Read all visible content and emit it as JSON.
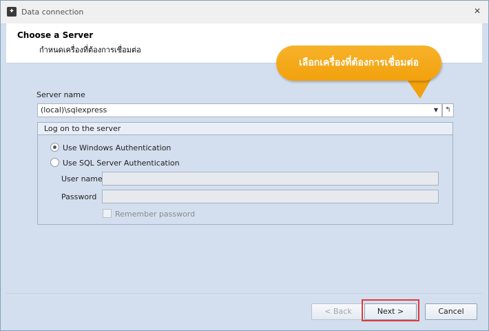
{
  "window": {
    "title": "Data connection",
    "close_glyph": "✕",
    "app_icon": "wizard-icon"
  },
  "header": {
    "title": "Choose a Server",
    "subtitle": "กำหนดเครื่องที่ต้องการเชื่อมต่อ"
  },
  "callout": {
    "text": "เลือกเครื่องที่ต้องการเชื่อมต่อ",
    "color": "#f2a10c"
  },
  "server": {
    "label": "Server name",
    "value": "(local)\\sqlexpress"
  },
  "logon_group": {
    "title": "Log on to the server",
    "windows_auth_label": "Use Windows Authentication",
    "sql_auth_label": "Use SQL Server Authentication",
    "selected": "windows",
    "username_label": "User name",
    "username_value": "",
    "password_label": "Password",
    "password_value": "",
    "remember_label": "Remember password"
  },
  "buttons": {
    "back": "< Back",
    "next": "Next >",
    "cancel": "Cancel"
  },
  "colors": {
    "highlight": "#e03a3a",
    "background": "#d3dfee"
  }
}
